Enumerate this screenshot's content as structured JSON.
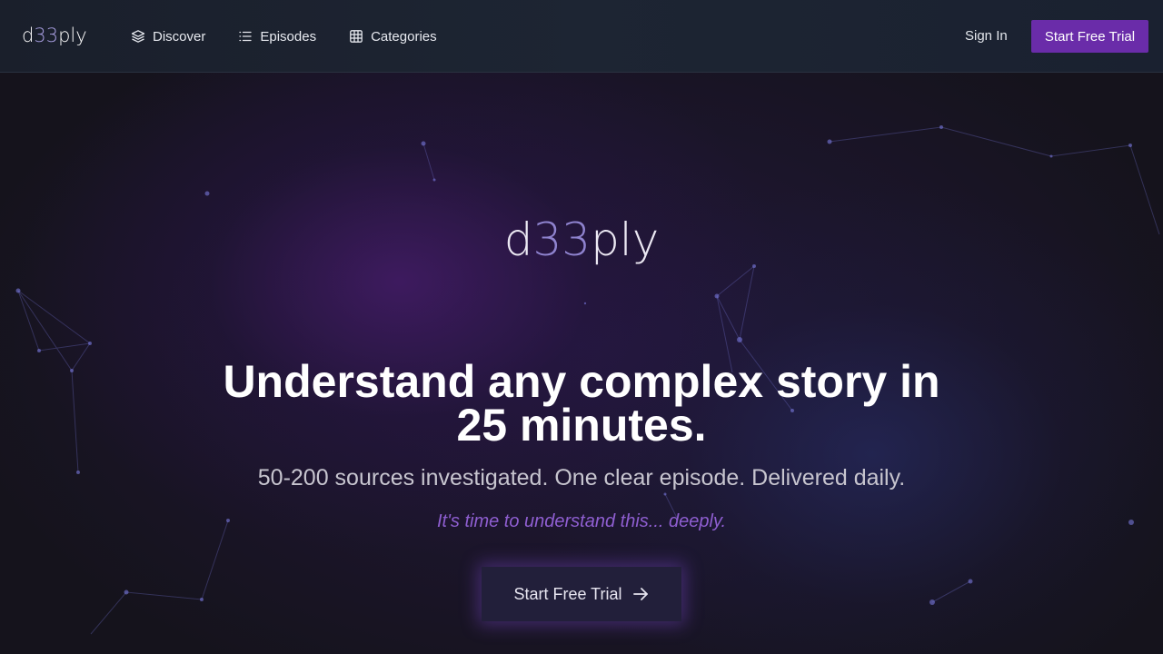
{
  "header": {
    "logo": {
      "prefix": "d",
      "accent": "33",
      "suffix": "ply"
    },
    "nav": [
      {
        "label": "Discover",
        "icon": "layers-icon"
      },
      {
        "label": "Episodes",
        "icon": "list-icon"
      },
      {
        "label": "Categories",
        "icon": "grid-icon"
      }
    ],
    "sign_in": "Sign In",
    "trial_button": "Start Free Trial"
  },
  "hero": {
    "logo": {
      "prefix": "d",
      "accent": "33",
      "suffix": "ply"
    },
    "headline_line1": "Understand any complex story in",
    "headline_line2": "25 minutes.",
    "subhead": "50-200 sources investigated. One clear episode. Delivered daily.",
    "tagline": "It's time to understand this... deeply.",
    "cta_label": "Start Free Trial",
    "cta_icon": "arrow-right-icon"
  },
  "colors": {
    "brand_accent": "#6a2ca9",
    "logo_accent": "#a79ee0",
    "tagline": "#8e5ed0"
  }
}
